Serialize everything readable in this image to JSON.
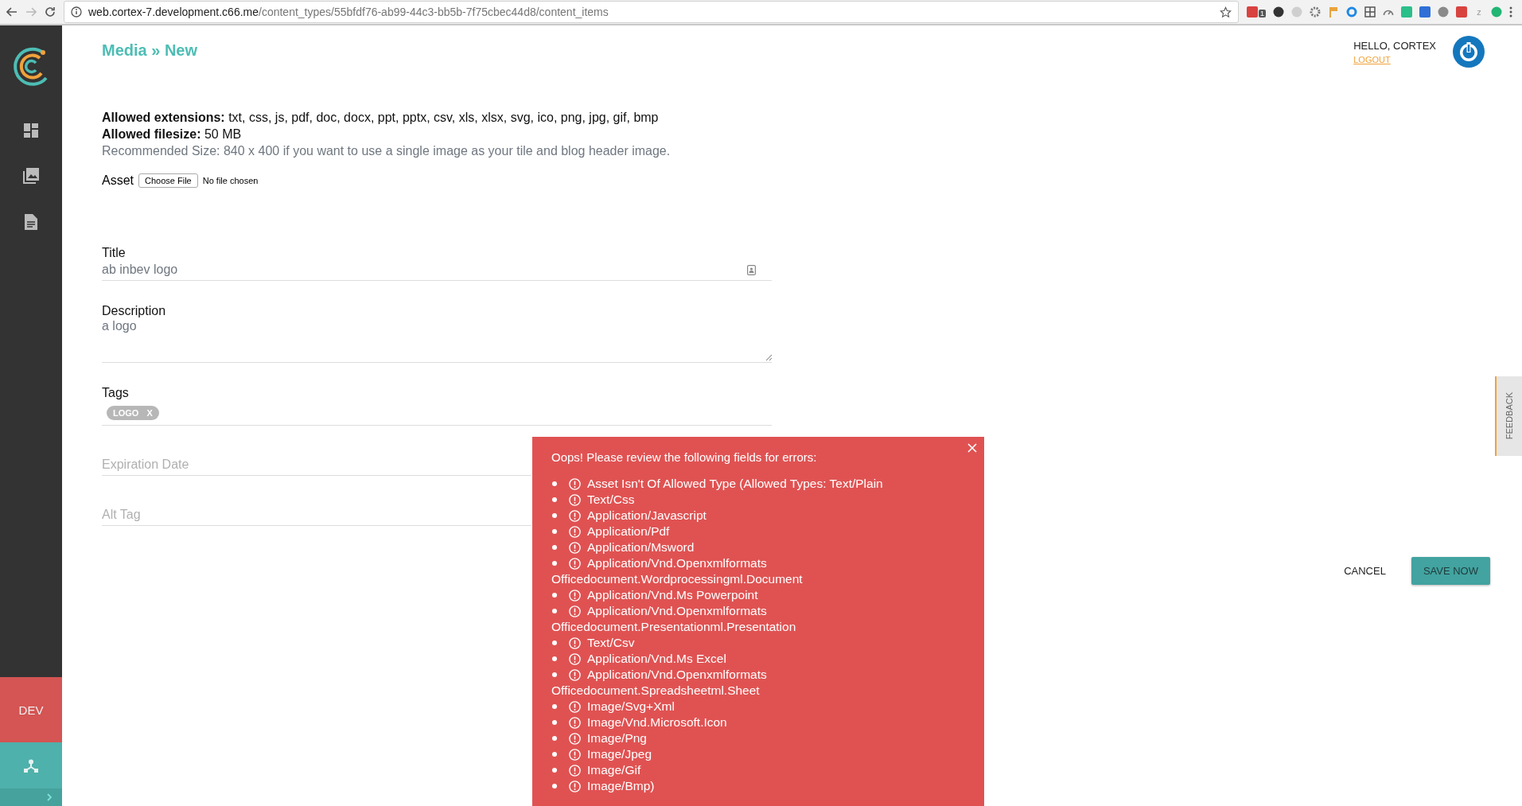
{
  "browser": {
    "url_host": "web.cortex-7.development.c66.me",
    "url_path": "/content_types/55bfdf76-ab99-44c3-bb5b-7f75cbec44d8/content_items",
    "extensions": [
      {
        "kind": "square",
        "badge": "1"
      },
      {
        "kind": "circle"
      },
      {
        "kind": "circle"
      },
      {
        "kind": "gear"
      },
      {
        "kind": "flag"
      },
      {
        "kind": "ring"
      },
      {
        "kind": "grid"
      },
      {
        "kind": "gauge"
      },
      {
        "kind": "square"
      },
      {
        "kind": "square"
      },
      {
        "kind": "circle"
      },
      {
        "kind": "square"
      },
      {
        "kind": "letter",
        "label": "z"
      },
      {
        "kind": "circle"
      },
      {
        "kind": "menu"
      }
    ]
  },
  "sidebar": {
    "items": [
      {
        "kind": "dashboard"
      },
      {
        "kind": "images"
      },
      {
        "kind": "document"
      }
    ],
    "environment": "DEV"
  },
  "breadcrumb": "Media » New",
  "user": {
    "greeting": "HELLO, CORTEX",
    "logout": "LOGOUT"
  },
  "info": [
    "**Allowed extensions:** txt, css, js, pdf, doc, docx, ppt, pptx, csv, xls, xlsx, svg, ico, png, jpg, gif, bmp",
    "**Allowed filesize:** 50 MB"
  ],
  "recommendation": "Recommended Size: 840 x 400 if you want to use a single image as your tile and blog header image.",
  "asset": {
    "label": "Asset",
    "button": "Choose File",
    "status": "No file chosen"
  },
  "fields": [
    {
      "kind": "textcard",
      "label": "Title",
      "value": "ab inbev logo"
    },
    {
      "kind": "textarea",
      "label": "Description",
      "value": "a logo"
    },
    {
      "kind": "tags",
      "label": "Tags",
      "tags": [
        {
          "label": "LOGO",
          "remove": "X"
        }
      ]
    },
    {
      "kind": "text",
      "placeholder": "Expiration Date"
    },
    {
      "kind": "text",
      "placeholder": "Alt Tag"
    }
  ],
  "actions": {
    "cancel": "CANCEL",
    "save": "SAVE NOW"
  },
  "feedback": "FEEDBACK",
  "error": {
    "title": "Oops! Please review the following fields for errors:",
    "items": [
      {
        "text": "Asset Isn't Of Allowed Type (Allowed Types: Text/Plain"
      },
      {
        "text": "Text/Css"
      },
      {
        "text": "Application/Javascript"
      },
      {
        "text": "Application/Pdf"
      },
      {
        "text": "Application/Msword"
      },
      {
        "text": "Application/Vnd.Openxmlformats",
        "continuation": "Officedocument.Wordprocessingml.Document"
      },
      {
        "text": "Application/Vnd.Ms Powerpoint"
      },
      {
        "text": "Application/Vnd.Openxmlformats",
        "continuation": "Officedocument.Presentationml.Presentation"
      },
      {
        "text": "Text/Csv"
      },
      {
        "text": "Application/Vnd.Ms Excel"
      },
      {
        "text": "Application/Vnd.Openxmlformats",
        "continuation": "Officedocument.Spreadsheetml.Sheet"
      },
      {
        "text": "Image/Svg+Xml"
      },
      {
        "text": "Image/Vnd.Microsoft.Icon"
      },
      {
        "text": "Image/Png"
      },
      {
        "text": "Image/Jpeg"
      },
      {
        "text": "Image/Gif"
      },
      {
        "text": "Image/Bmp)"
      }
    ]
  }
}
